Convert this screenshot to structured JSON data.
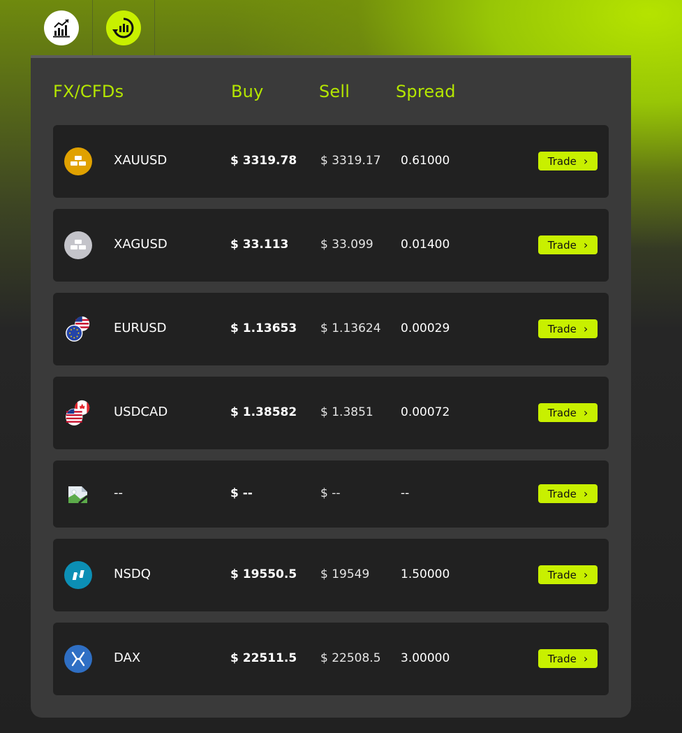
{
  "tabs": [
    {
      "icon": "bar-chart-icon"
    },
    {
      "icon": "live-chart-icon"
    }
  ],
  "header": {
    "title": "FX/CFDs",
    "buy": "Buy",
    "sell": "Sell",
    "spread": "Spread"
  },
  "rows": [
    {
      "symbol": "XAUUSD",
      "buy": "$ 3319.78",
      "sell": "$ 3319.17",
      "spread": "0.61000",
      "trade": "Trade",
      "icon": "gold-bars-icon"
    },
    {
      "symbol": "XAGUSD",
      "buy": "$ 33.113",
      "sell": "$ 33.099",
      "spread": "0.01400",
      "trade": "Trade",
      "icon": "silver-bars-icon"
    },
    {
      "symbol": "EURUSD",
      "buy": "$ 1.13653",
      "sell": "$ 1.13624",
      "spread": "0.00029",
      "trade": "Trade",
      "icon": "eur-usd-flags-icon"
    },
    {
      "symbol": "USDCAD",
      "buy": "$ 1.38582",
      "sell": "$ 1.3851",
      "spread": "0.00072",
      "trade": "Trade",
      "icon": "usd-cad-flags-icon"
    },
    {
      "symbol": "--",
      "buy": "$ --",
      "sell": "$ --",
      "spread": "--",
      "trade": "Trade",
      "icon": "broken-image-icon"
    },
    {
      "symbol": "NSDQ",
      "buy": "$ 19550.5",
      "sell": "$ 19549",
      "spread": "1.50000",
      "trade": "Trade",
      "icon": "nasdaq-logo-icon"
    },
    {
      "symbol": "DAX",
      "buy": "$ 22511.5",
      "sell": "$ 22508.5",
      "spread": "3.00000",
      "trade": "Trade",
      "icon": "dax-logo-icon"
    }
  ],
  "colors": {
    "accent": "#c8f000",
    "heading": "#b4e600",
    "panel": "#3a3a3a",
    "row": "#212121"
  }
}
